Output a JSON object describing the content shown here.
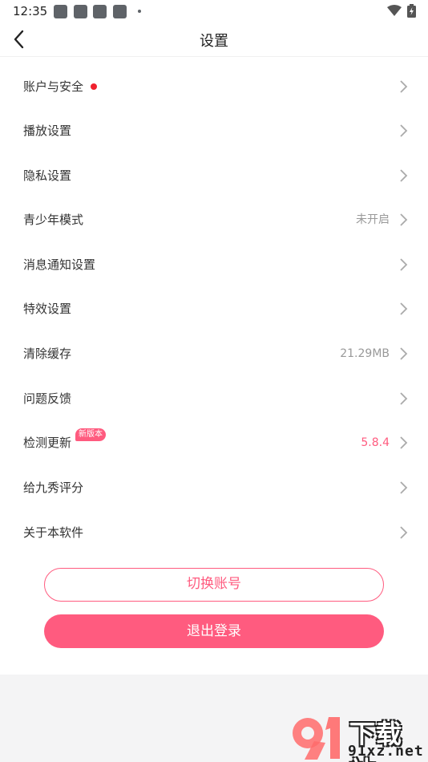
{
  "status_bar": {
    "time": "12:35",
    "icons": [
      "notification-icon",
      "notification-icon",
      "notification-icon",
      "notification-icon",
      "more-dot-icon",
      "wifi-icon",
      "battery-icon"
    ]
  },
  "header": {
    "title": "设置",
    "back_icon": "chevron-left-icon"
  },
  "settings": {
    "items": [
      {
        "label": "账户与安全",
        "value": "",
        "has_red_dot": true
      },
      {
        "label": "播放设置",
        "value": ""
      },
      {
        "label": "隐私设置",
        "value": ""
      },
      {
        "label": "青少年模式",
        "value": "未开启"
      },
      {
        "label": "消息通知设置",
        "value": ""
      },
      {
        "label": "特效设置",
        "value": ""
      },
      {
        "label": "清除缓存",
        "value": "21.29MB"
      },
      {
        "label": "问题反馈",
        "value": ""
      },
      {
        "label": "检测更新",
        "value": "5.8.4",
        "badge": "新版本"
      },
      {
        "label": "给九秀评分",
        "value": ""
      },
      {
        "label": "关于本软件",
        "value": ""
      }
    ]
  },
  "actions": {
    "switch_account": "切换账号",
    "logout": "退出登录"
  },
  "colors": {
    "accent": "#ff5b7f",
    "red_dot": "#f0222e",
    "footer_bg": "#f4f4f5"
  },
  "watermark": {
    "top": "下载站",
    "bottom": "91xz.net"
  }
}
